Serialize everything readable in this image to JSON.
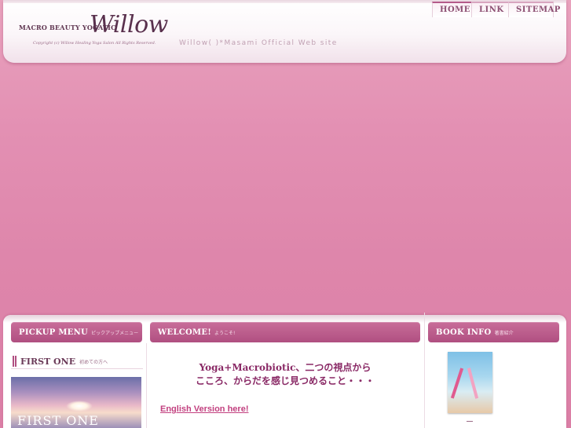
{
  "header": {
    "logo_tagline": "MACRO BEAUTY YOGATIC",
    "logo_name": "Willow",
    "copyright": "Copyright (c) Willow Healing Yoga Salon All Rights Reserved.",
    "site_subtitle": "Willow(   )*Masami Official Web site"
  },
  "nav": {
    "items": [
      {
        "label": "HOME"
      },
      {
        "label": "LINK"
      },
      {
        "label": "SITEMAP"
      }
    ]
  },
  "sections": {
    "pickup": {
      "title": "PICKUP MENU",
      "subtitle": "ピックアップメニュー"
    },
    "welcome": {
      "title": "WELCOME!",
      "subtitle": "ようこそ!"
    },
    "book": {
      "title": "BOOK INFO",
      "subtitle": "著書紹介"
    }
  },
  "first_one": {
    "title": "FIRST ONE",
    "subtitle": "初めての方へ",
    "banner_text": "FIRST ONE"
  },
  "welcome_content": {
    "headline_1": "Yoga+Macrobiotic、二つの視点から",
    "headline_2": "こころ、からだを感じ見つめること・・・",
    "english_link": "English Version here!"
  },
  "colors": {
    "background": "#e390b3",
    "tab_bar": "#b04f81",
    "link": "#c2407f",
    "headline": "#8a2a66"
  }
}
